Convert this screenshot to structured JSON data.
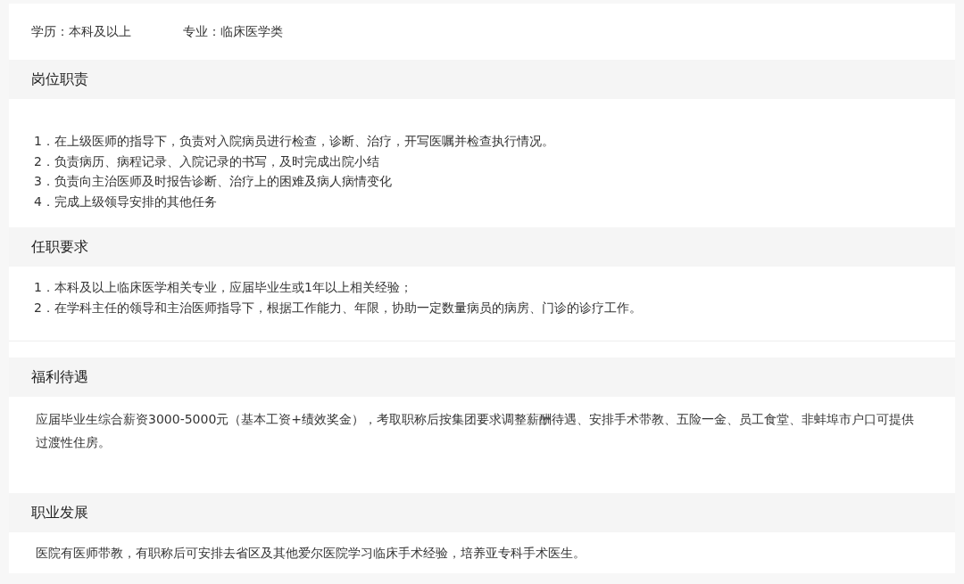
{
  "info": [
    {
      "label": "学历：本科及以上"
    },
    {
      "label": "专业：临床医学类"
    }
  ],
  "sections": [
    {
      "title": "岗位职责",
      "kind": "list",
      "items": [
        "1．在上级医师的指导下，负责对入院病员进行检查，诊断、治疗，开写医嘱并检查执行情况。",
        "2．负责病历、病程记录、入院记录的书写，及时完成出院小结",
        "3．负责向主治医师及时报告诊断、治疗上的困难及病人病情变化",
        "4．完成上级领导安排的其他任务"
      ]
    },
    {
      "title": "任职要求",
      "kind": "list",
      "items": [
        "1．本科及以上临床医学相关专业，应届毕业生或1年以上相关经验；",
        "2．在学科主任的领导和主治医师指导下，根据工作能力、年限，协助一定数量病员的病房、门诊的诊疗工作。"
      ]
    },
    {
      "title": "福利待遇",
      "kind": "paragraph",
      "text": "应届毕业生综合薪资3000-5000元（基本工资+绩效奖金），考取职称后按集团要求调整薪酬待遇、安排手术带教、五险一金、员工食堂、非蚌埠市户口可提供过渡性住房。"
    },
    {
      "title": "职业发展",
      "kind": "paragraph",
      "text": "医院有医师带教，有职称后可安排去省区及其他爱尔医院学习临床手术经验，培养亚专科手术医生。"
    }
  ]
}
